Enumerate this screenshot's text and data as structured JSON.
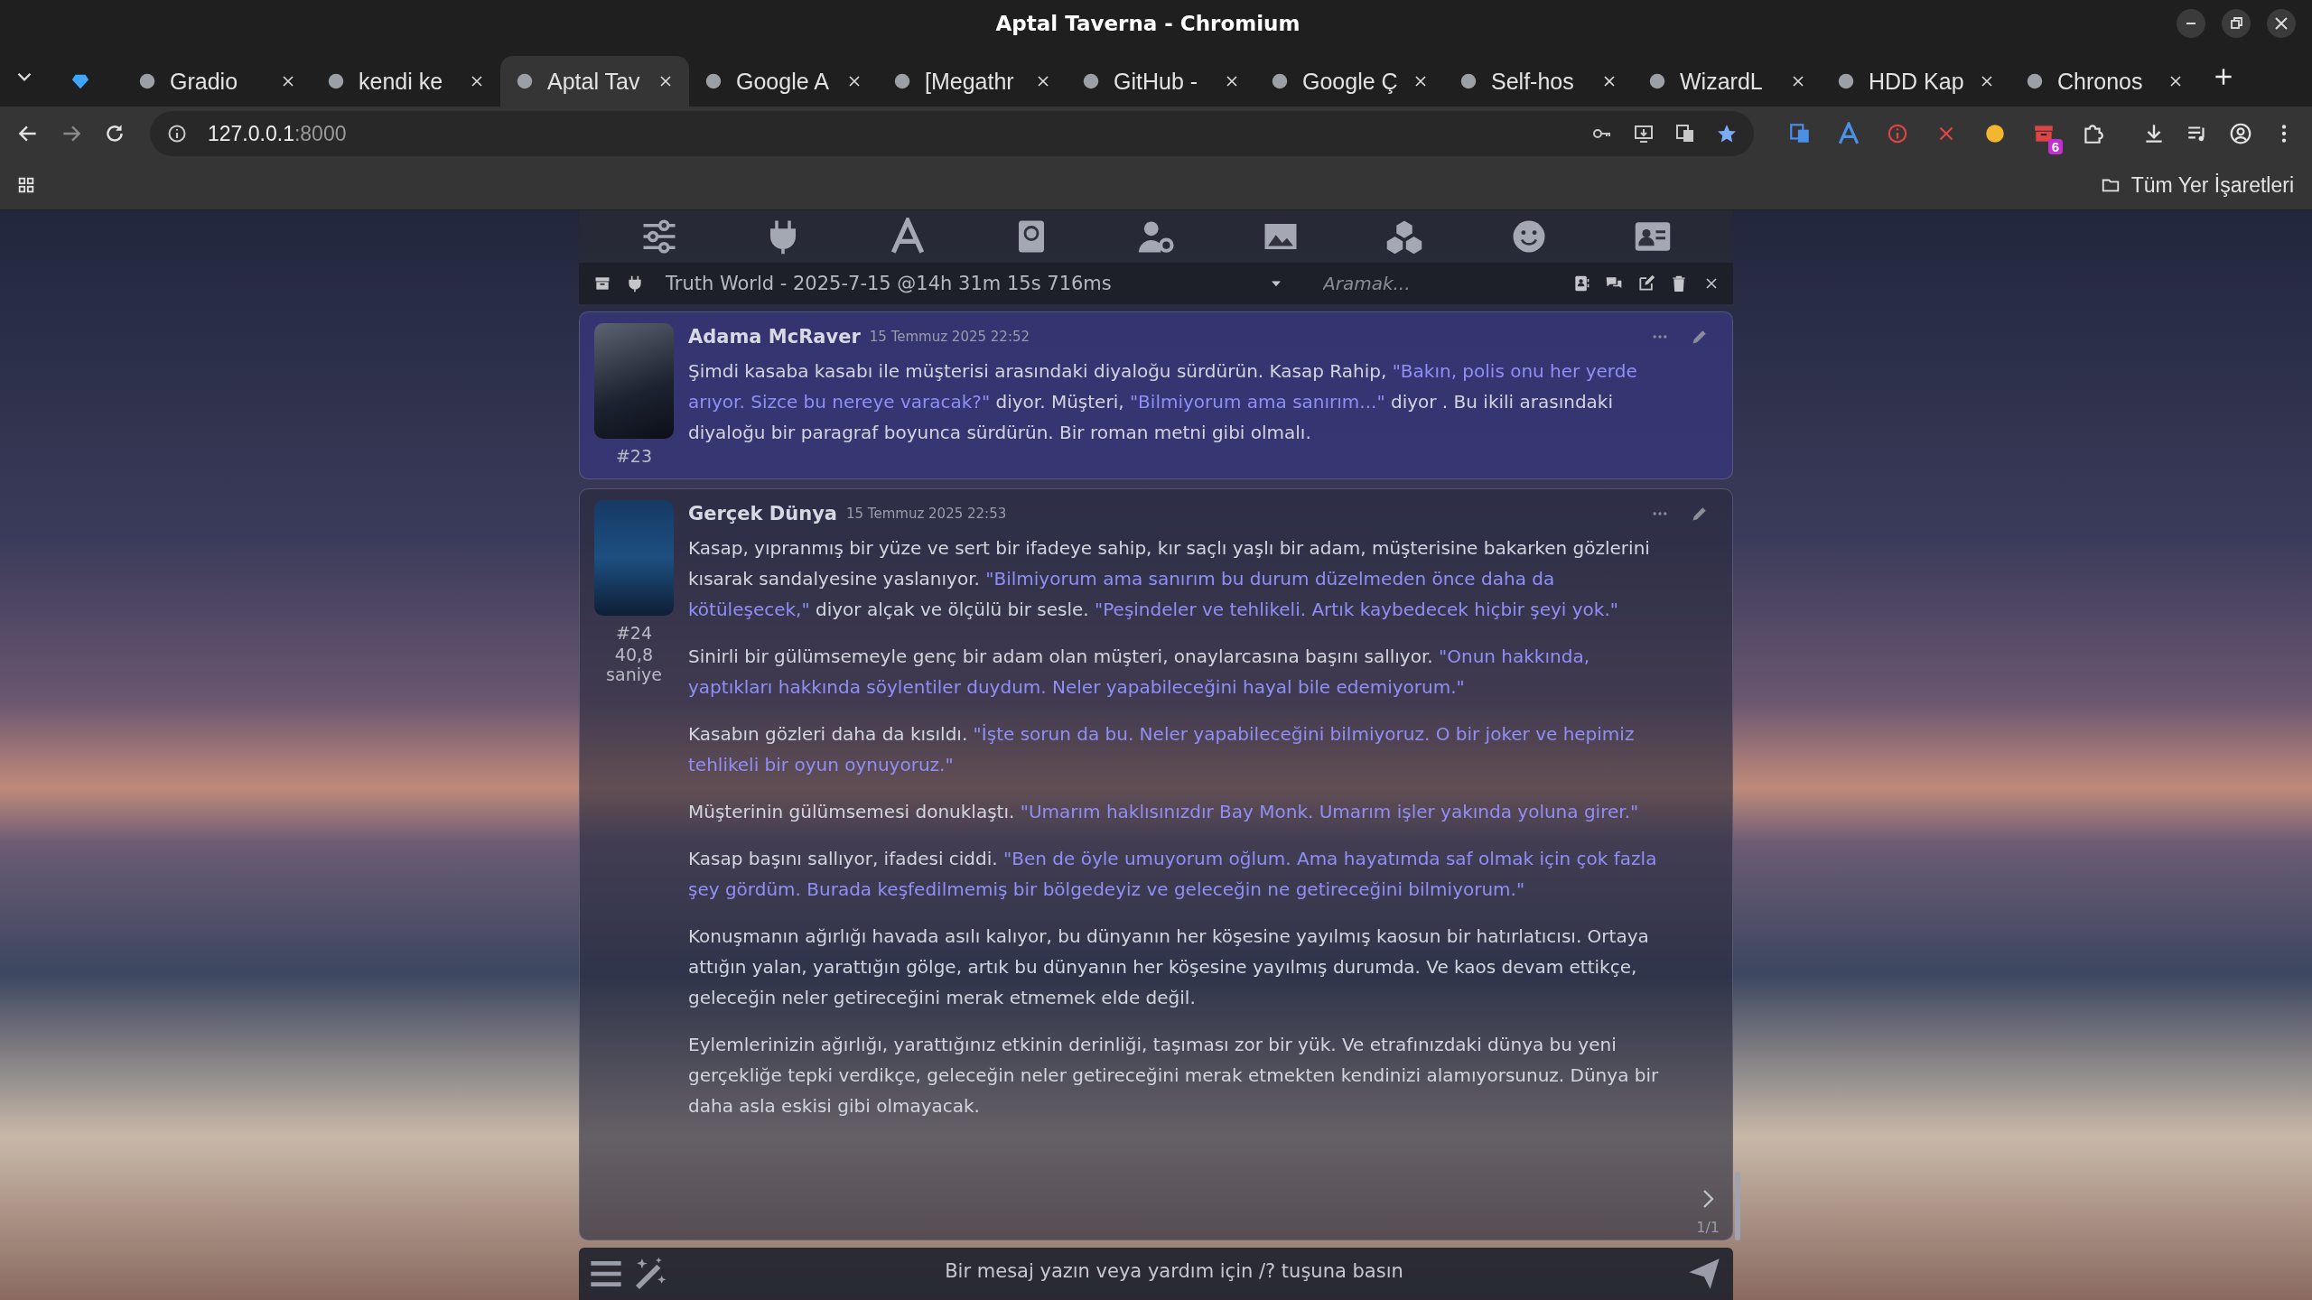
{
  "window": {
    "title": "Aptal Taverna - Chromium"
  },
  "tabs": [
    {
      "kind": "pinned",
      "selected": false
    },
    {
      "kind": "page",
      "label": "Gradio",
      "selected": false
    },
    {
      "kind": "page",
      "label": "kendi ke",
      "selected": false
    },
    {
      "kind": "page",
      "label": "Aptal Tav",
      "selected": true
    },
    {
      "kind": "page",
      "label": "Google A",
      "selected": false
    },
    {
      "kind": "page",
      "label": "[Megathr",
      "selected": false
    },
    {
      "kind": "page",
      "label": "GitHub -",
      "selected": false
    },
    {
      "kind": "page",
      "label": "Google Ç",
      "selected": false
    },
    {
      "kind": "page",
      "label": "Self-hos",
      "selected": false
    },
    {
      "kind": "page",
      "label": "WizardL",
      "selected": false
    },
    {
      "kind": "page",
      "label": "HDD Kap",
      "selected": false
    },
    {
      "kind": "page",
      "label": "Chronos",
      "selected": false
    }
  ],
  "address": {
    "host": "127.0.0.1",
    "port": ":8000"
  },
  "extensions": {
    "badge": "6"
  },
  "bookmarks": {
    "all_bookmarks": "Tüm Yer İşaretleri"
  },
  "chat": {
    "title": "Truth World - 2025-7-15 @14h 31m 15s 716ms",
    "search_placeholder": "Aramak..."
  },
  "messages": [
    {
      "kind": "user",
      "name": "Adama McRaver",
      "date": "15 Temmuz 2025 22:52",
      "id": "#23",
      "paragraphs": [
        [
          {
            "kind": "text",
            "text": "Şimdi kasaba kasabı ile müşterisi arasındaki diyaloğu sürdürün. Kasap Rahip, "
          },
          {
            "kind": "quote",
            "text": "\"Bakın, polis onu her yerde arıyor. Sizce bu nereye varacak?\""
          },
          {
            "kind": "text",
            "text": " diyor. Müşteri, "
          },
          {
            "kind": "quote",
            "text": "\"Bilmiyorum ama sanırım...\""
          },
          {
            "kind": "text",
            "text": " diyor . Bu ikili arasındaki diyaloğu bir paragraf boyunca sürdürün. Bir roman metni gibi olmalı."
          }
        ]
      ]
    },
    {
      "kind": "character",
      "name": "Gerçek Dünya",
      "date": "15 Temmuz 2025 22:53",
      "id": "#24",
      "timer": "40,8 saniye",
      "swipe_counter": "1/1",
      "paragraphs": [
        [
          {
            "kind": "text",
            "text": "Kasap, yıpranmış bir yüze ve sert bir ifadeye sahip, kır saçlı yaşlı bir adam, müşterisine bakarken gözlerini kısarak sandalyesine yaslanıyor. "
          },
          {
            "kind": "quote",
            "text": "\"Bilmiyorum ama sanırım bu durum düzelmeden önce daha da kötüleşecek,\""
          },
          {
            "kind": "text",
            "text": " diyor alçak ve ölçülü bir sesle. "
          },
          {
            "kind": "quote",
            "text": "\"Peşindeler ve tehlikeli. Artık kaybedecek hiçbir şeyi yok.\""
          }
        ],
        [
          {
            "kind": "text",
            "text": "Sinirli bir gülümsemeyle genç bir adam olan müşteri, onaylarcasına başını sallıyor. "
          },
          {
            "kind": "quote",
            "text": "\"Onun hakkında, yaptıkları hakkında söylentiler duydum. Neler yapabileceğini hayal bile edemiyorum.\""
          }
        ],
        [
          {
            "kind": "text",
            "text": "Kasabın gözleri daha da kısıldı. "
          },
          {
            "kind": "quote",
            "text": "\"İşte sorun da bu. Neler yapabileceğini bilmiyoruz. O bir joker ve hepimiz tehlikeli bir oyun oynuyoruz.\""
          }
        ],
        [
          {
            "kind": "text",
            "text": "Müşterinin gülümsemesi donuklaştı. "
          },
          {
            "kind": "quote",
            "text": "\"Umarım haklısınızdır Bay Monk. Umarım işler yakında yoluna girer.\""
          }
        ],
        [
          {
            "kind": "text",
            "text": "Kasap başını sallıyor, ifadesi ciddi. "
          },
          {
            "kind": "quote",
            "text": "\"Ben de öyle umuyorum oğlum. Ama hayatımda saf olmak için çok fazla şey gördüm. Burada keşfedilmemiş bir bölgedeyiz ve geleceğin ne getireceğini bilmiyorum.\""
          }
        ],
        [
          {
            "kind": "text",
            "text": "Konuşmanın ağırlığı havada asılı kalıyor, bu dünyanın her köşesine yayılmış kaosun bir hatırlatıcısı. Ortaya attığın yalan, yarattığın gölge, artık bu dünyanın her köşesine yayılmış durumda. Ve kaos devam ettikçe, geleceğin neler getireceğini merak etmemek elde değil."
          }
        ],
        [
          {
            "kind": "text",
            "text": "Eylemlerinizin ağırlığı, yarattığınız etkinin derinliği, taşıması zor bir yük. Ve etrafınızdaki dünya bu yeni gerçekliğe tepki verdikçe, geleceğin neler getireceğini merak etmekten kendinizi alamıyorsunuz. Dünya bir daha asla eskisi gibi olmayacak."
          }
        ]
      ]
    }
  ],
  "input": {
    "placeholder": "Bir mesaj yazın veya yardım için /? tuşuna basın"
  }
}
